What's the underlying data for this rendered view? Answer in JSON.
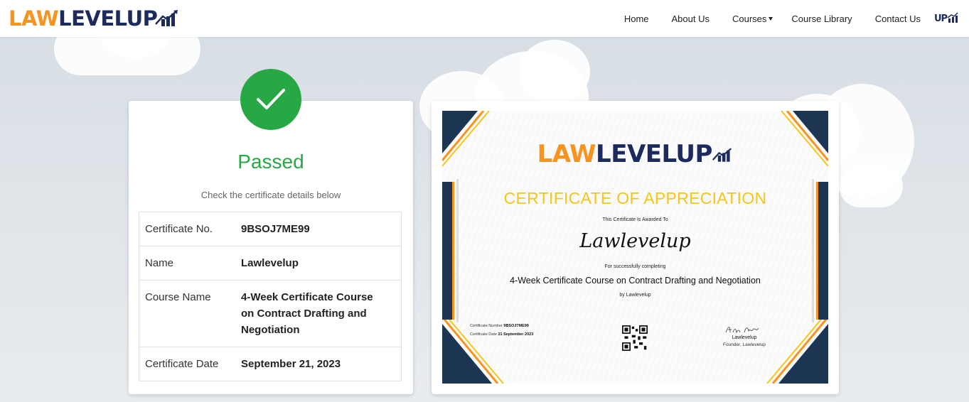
{
  "header": {
    "logo": {
      "part1": "LAW",
      "part2": "LEVELUP"
    },
    "nav": [
      {
        "label": "Home"
      },
      {
        "label": "About Us"
      },
      {
        "label": "Courses"
      },
      {
        "label": "Course Library"
      },
      {
        "label": "Contact Us"
      }
    ],
    "brand_mark": "UPM"
  },
  "result": {
    "status": "Passed",
    "subtitle": "Check the certificate details below",
    "details": [
      {
        "label": "Certificate No.",
        "value": "9BSOJ7ME99"
      },
      {
        "label": "Name",
        "value": "Lawlevelup"
      },
      {
        "label": "Course Name",
        "value": "4-Week Certificate Course on Contract Drafting and Negotiation"
      },
      {
        "label": "Certificate Date",
        "value": "September 21, 2023"
      }
    ]
  },
  "certificate": {
    "logo_part1": "LAW",
    "logo_part2": "LEVELUP",
    "title": "CERTIFICATE OF APPRECIATION",
    "awarded_to": "This Certificate Is Awarded To",
    "recipient": "Lawlevelup",
    "for_text": "For successfully completing",
    "course": "4-Week Certificate Course on Contract Drafting and Negotiation",
    "by_text": "by Lawlevelup",
    "number_label": "Certificate Number",
    "number_value": "9BSOJ7ME99",
    "date_label": "Certificate Date",
    "date_value": "21 September 2023",
    "signatory": "Lawlevelup",
    "signatory_role": "Founder, Lawlevelup"
  },
  "colors": {
    "success": "#28a745",
    "brand_orange": "#f7931e",
    "brand_navy": "#1c2a5e",
    "cert_gold": "#f5c518",
    "cert_frame": "#1c3553"
  },
  "icons": [
    "checkmark-icon",
    "chevron-down-icon",
    "chart-bars-icon",
    "qr-code"
  ]
}
